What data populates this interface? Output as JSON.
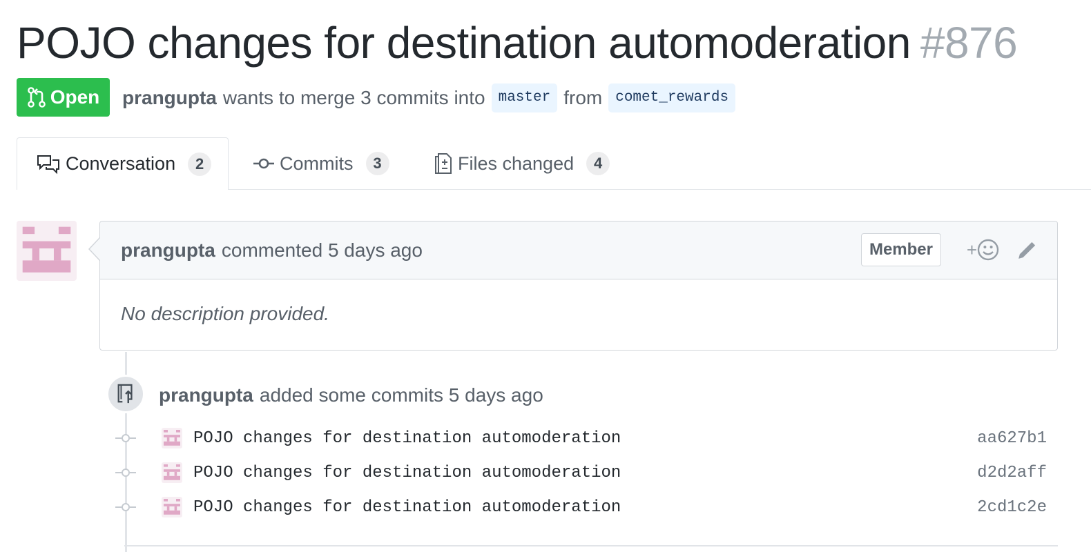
{
  "pr": {
    "title": "POJO changes for destination automoderation",
    "number": "#876",
    "state": "Open",
    "author": "prangupta",
    "merge_text": "wants to merge 3 commits into",
    "base_branch": "master",
    "from_text": "from",
    "head_branch": "comet_rewards"
  },
  "tabs": [
    {
      "label": "Conversation",
      "count": "2",
      "icon": "comment-discussion-icon",
      "selected": true
    },
    {
      "label": "Commits",
      "count": "3",
      "icon": "git-commit-icon",
      "selected": false
    },
    {
      "label": "Files changed",
      "count": "4",
      "icon": "file-diff-icon",
      "selected": false
    }
  ],
  "comment": {
    "author": "prangupta",
    "action": "commented 5 days ago",
    "badge": "Member",
    "reaction_plus": "+",
    "body": "No description provided."
  },
  "push_event": {
    "author": "prangupta",
    "action": "added some commits 5 days ago"
  },
  "commits": [
    {
      "message": "POJO changes for destination automoderation",
      "sha": "aa627b1"
    },
    {
      "message": "POJO changes for destination automoderation",
      "sha": "d2d2aff"
    },
    {
      "message": "POJO changes for destination automoderation",
      "sha": "2cd1c2e"
    }
  ],
  "colors": {
    "open_green": "#2cbe4e",
    "avatar_pink": "#e0a8c6"
  }
}
